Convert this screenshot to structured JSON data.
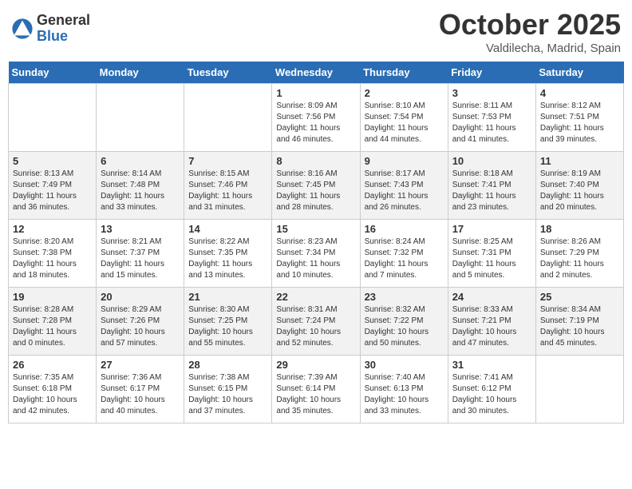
{
  "header": {
    "logo_general": "General",
    "logo_blue": "Blue",
    "month_title": "October 2025",
    "location": "Valdilecha, Madrid, Spain"
  },
  "days_of_week": [
    "Sunday",
    "Monday",
    "Tuesday",
    "Wednesday",
    "Thursday",
    "Friday",
    "Saturday"
  ],
  "weeks": [
    [
      {
        "day": "",
        "info": ""
      },
      {
        "day": "",
        "info": ""
      },
      {
        "day": "",
        "info": ""
      },
      {
        "day": "1",
        "info": "Sunrise: 8:09 AM\nSunset: 7:56 PM\nDaylight: 11 hours and 46 minutes."
      },
      {
        "day": "2",
        "info": "Sunrise: 8:10 AM\nSunset: 7:54 PM\nDaylight: 11 hours and 44 minutes."
      },
      {
        "day": "3",
        "info": "Sunrise: 8:11 AM\nSunset: 7:53 PM\nDaylight: 11 hours and 41 minutes."
      },
      {
        "day": "4",
        "info": "Sunrise: 8:12 AM\nSunset: 7:51 PM\nDaylight: 11 hours and 39 minutes."
      }
    ],
    [
      {
        "day": "5",
        "info": "Sunrise: 8:13 AM\nSunset: 7:49 PM\nDaylight: 11 hours and 36 minutes."
      },
      {
        "day": "6",
        "info": "Sunrise: 8:14 AM\nSunset: 7:48 PM\nDaylight: 11 hours and 33 minutes."
      },
      {
        "day": "7",
        "info": "Sunrise: 8:15 AM\nSunset: 7:46 PM\nDaylight: 11 hours and 31 minutes."
      },
      {
        "day": "8",
        "info": "Sunrise: 8:16 AM\nSunset: 7:45 PM\nDaylight: 11 hours and 28 minutes."
      },
      {
        "day": "9",
        "info": "Sunrise: 8:17 AM\nSunset: 7:43 PM\nDaylight: 11 hours and 26 minutes."
      },
      {
        "day": "10",
        "info": "Sunrise: 8:18 AM\nSunset: 7:41 PM\nDaylight: 11 hours and 23 minutes."
      },
      {
        "day": "11",
        "info": "Sunrise: 8:19 AM\nSunset: 7:40 PM\nDaylight: 11 hours and 20 minutes."
      }
    ],
    [
      {
        "day": "12",
        "info": "Sunrise: 8:20 AM\nSunset: 7:38 PM\nDaylight: 11 hours and 18 minutes."
      },
      {
        "day": "13",
        "info": "Sunrise: 8:21 AM\nSunset: 7:37 PM\nDaylight: 11 hours and 15 minutes."
      },
      {
        "day": "14",
        "info": "Sunrise: 8:22 AM\nSunset: 7:35 PM\nDaylight: 11 hours and 13 minutes."
      },
      {
        "day": "15",
        "info": "Sunrise: 8:23 AM\nSunset: 7:34 PM\nDaylight: 11 hours and 10 minutes."
      },
      {
        "day": "16",
        "info": "Sunrise: 8:24 AM\nSunset: 7:32 PM\nDaylight: 11 hours and 7 minutes."
      },
      {
        "day": "17",
        "info": "Sunrise: 8:25 AM\nSunset: 7:31 PM\nDaylight: 11 hours and 5 minutes."
      },
      {
        "day": "18",
        "info": "Sunrise: 8:26 AM\nSunset: 7:29 PM\nDaylight: 11 hours and 2 minutes."
      }
    ],
    [
      {
        "day": "19",
        "info": "Sunrise: 8:28 AM\nSunset: 7:28 PM\nDaylight: 11 hours and 0 minutes."
      },
      {
        "day": "20",
        "info": "Sunrise: 8:29 AM\nSunset: 7:26 PM\nDaylight: 10 hours and 57 minutes."
      },
      {
        "day": "21",
        "info": "Sunrise: 8:30 AM\nSunset: 7:25 PM\nDaylight: 10 hours and 55 minutes."
      },
      {
        "day": "22",
        "info": "Sunrise: 8:31 AM\nSunset: 7:24 PM\nDaylight: 10 hours and 52 minutes."
      },
      {
        "day": "23",
        "info": "Sunrise: 8:32 AM\nSunset: 7:22 PM\nDaylight: 10 hours and 50 minutes."
      },
      {
        "day": "24",
        "info": "Sunrise: 8:33 AM\nSunset: 7:21 PM\nDaylight: 10 hours and 47 minutes."
      },
      {
        "day": "25",
        "info": "Sunrise: 8:34 AM\nSunset: 7:19 PM\nDaylight: 10 hours and 45 minutes."
      }
    ],
    [
      {
        "day": "26",
        "info": "Sunrise: 7:35 AM\nSunset: 6:18 PM\nDaylight: 10 hours and 42 minutes."
      },
      {
        "day": "27",
        "info": "Sunrise: 7:36 AM\nSunset: 6:17 PM\nDaylight: 10 hours and 40 minutes."
      },
      {
        "day": "28",
        "info": "Sunrise: 7:38 AM\nSunset: 6:15 PM\nDaylight: 10 hours and 37 minutes."
      },
      {
        "day": "29",
        "info": "Sunrise: 7:39 AM\nSunset: 6:14 PM\nDaylight: 10 hours and 35 minutes."
      },
      {
        "day": "30",
        "info": "Sunrise: 7:40 AM\nSunset: 6:13 PM\nDaylight: 10 hours and 33 minutes."
      },
      {
        "day": "31",
        "info": "Sunrise: 7:41 AM\nSunset: 6:12 PM\nDaylight: 10 hours and 30 minutes."
      },
      {
        "day": "",
        "info": ""
      }
    ]
  ]
}
